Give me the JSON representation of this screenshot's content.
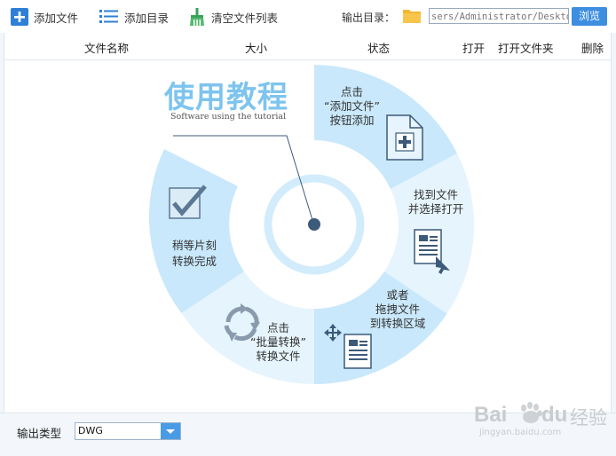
{
  "toolbar": {
    "add_file": "添加文件",
    "add_dir": "添加目录",
    "clear_list": "清空文件列表",
    "output_dir_label": "输出目录：",
    "output_path": "sers/Administrator/Desktop",
    "browse": "浏览"
  },
  "columns": {
    "name": "文件名称",
    "size": "大小",
    "status": "状态",
    "open": "打开",
    "open_folder": "打开文件夹",
    "delete": "删除"
  },
  "tutorial": {
    "title": "使用教程",
    "subtitle": "Software using the tutorial",
    "step1": [
      "点击",
      "“添加文件”",
      "按钮添加"
    ],
    "step2": [
      "找到文件",
      "并选择打开"
    ],
    "step3": [
      "或者",
      "拖拽文件",
      "到转换区域"
    ],
    "step4": [
      "点击",
      "“批量转换”",
      "转换文件"
    ],
    "step5": [
      "稍等片刻",
      "转换完成"
    ]
  },
  "bottom": {
    "output_type_label": "输出类型",
    "output_type_value": "DWG"
  },
  "watermark": {
    "brand": "Bai",
    "brand2": "du",
    "suffix": "经验",
    "url": "jingyan.baidu.com"
  },
  "colors": {
    "accent": "#3d8ee0",
    "wheel_light": "#e3f2fc",
    "wheel_mid": "#c2e5fa",
    "title_blue": "#7ec4ee"
  }
}
